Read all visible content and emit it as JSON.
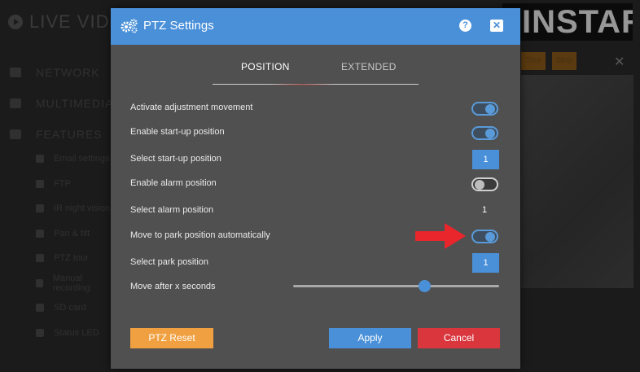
{
  "background": {
    "app_title": "LIVE VIDEO",
    "nav": [
      "NETWORK",
      "MULTIMEDIA",
      "FEATURES"
    ],
    "sub_nav": [
      "Email settings",
      "FTP",
      "IR night vision",
      "Pan & tilt",
      "PTZ tour",
      "Manual recording",
      "SD card",
      "Status LED"
    ],
    "logo_text": "INSTAR",
    "tabs": [
      "Tour",
      "Stop"
    ]
  },
  "modal": {
    "title": "PTZ Settings",
    "tabs": [
      {
        "label": "POSITION",
        "active": true
      },
      {
        "label": "EXTENDED",
        "active": false
      }
    ],
    "rows": [
      {
        "label": "Activate adjustment movement",
        "control": "toggle",
        "state": "on"
      },
      {
        "label": "Enable start-up position",
        "control": "toggle",
        "state": "on"
      },
      {
        "label": "Select start-up position",
        "control": "number",
        "value": "1"
      },
      {
        "label": "Enable alarm position",
        "control": "toggle",
        "state": "off"
      },
      {
        "label": "Select alarm position",
        "control": "text",
        "value": "1"
      },
      {
        "label": "Move to park position automatically",
        "control": "toggle",
        "state": "on"
      },
      {
        "label": "Select park position",
        "control": "number",
        "value": "1"
      },
      {
        "label": "Move after x seconds",
        "control": "slider",
        "value_fraction": 0.64
      }
    ],
    "buttons": {
      "reset": "PTZ Reset",
      "apply": "Apply",
      "cancel": "Cancel"
    },
    "colors": {
      "accent": "#4a90d9",
      "reset": "#f0a040",
      "cancel": "#d9363e",
      "annotation_arrow": "#e8262b"
    }
  }
}
